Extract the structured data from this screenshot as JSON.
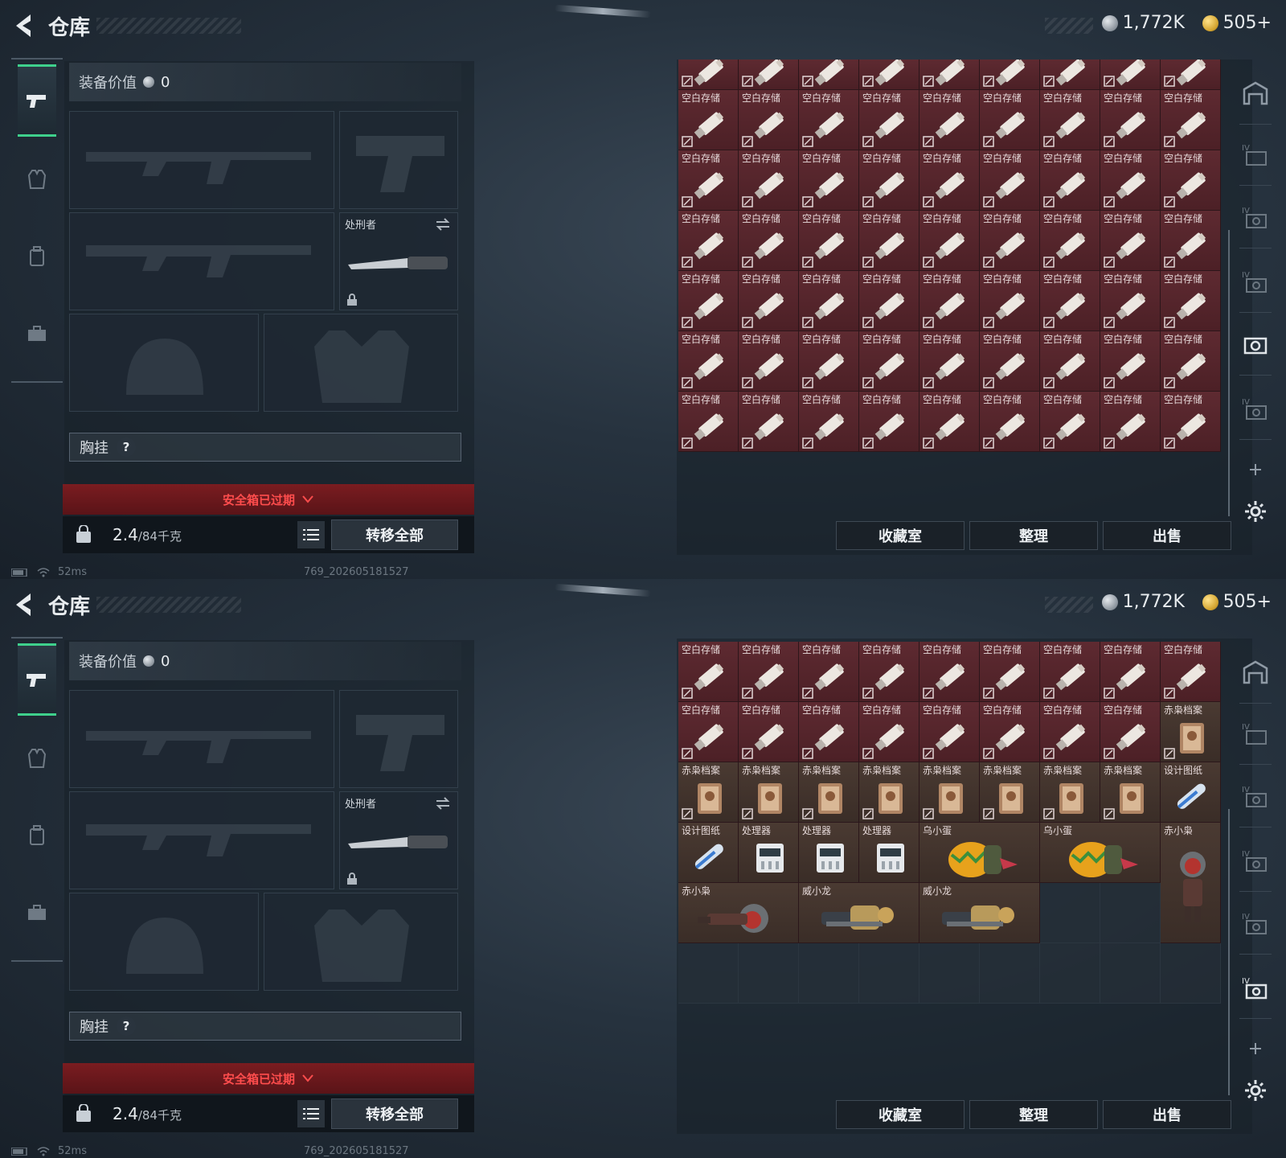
{
  "screens": [
    {
      "title": "仓库",
      "currency_silver": "1,772K",
      "currency_gold": "505+",
      "equip_label": "装备价值",
      "equip_value": "0",
      "knife_slot_label": "处刑者",
      "chest_label": "胸挂",
      "chest_help": "?",
      "expired_text": "安全箱已过期",
      "weight_value": "2.4",
      "weight_cap": "/84千克",
      "transfer_label": "转移全部",
      "ping": "52ms",
      "build_id": "769_202605181527",
      "buttons": [
        "收藏室",
        "整理",
        "出售"
      ]
    },
    {
      "title": "仓库",
      "currency_silver": "1,772K",
      "currency_gold": "505+",
      "equip_label": "装备价值",
      "equip_value": "0",
      "knife_slot_label": "处刑者",
      "chest_label": "胸挂",
      "chest_help": "?",
      "expired_text": "安全箱已过期",
      "weight_value": "2.4",
      "weight_cap": "/84千克",
      "transfer_label": "转移全部",
      "ping": "52ms",
      "build_id": "769_202605181527",
      "buttons": [
        "收藏室",
        "整理",
        "出售"
      ]
    }
  ],
  "grid1": {
    "top_row_label": "",
    "item_label": "空白存储",
    "rows": 7,
    "cols": 9
  },
  "grid2": {
    "items": [
      {
        "label": "空白存储",
        "kind": "usb"
      },
      {
        "label": "空白存储",
        "kind": "usb"
      },
      {
        "label": "空白存储",
        "kind": "usb"
      },
      {
        "label": "空白存储",
        "kind": "usb"
      },
      {
        "label": "空白存储",
        "kind": "usb"
      },
      {
        "label": "空白存储",
        "kind": "usb"
      },
      {
        "label": "空白存储",
        "kind": "usb"
      },
      {
        "label": "空白存储",
        "kind": "usb"
      },
      {
        "label": "空白存储",
        "kind": "usb"
      },
      {
        "label": "空白存储",
        "kind": "usb"
      },
      {
        "label": "空白存储",
        "kind": "usb"
      },
      {
        "label": "空白存储",
        "kind": "usb"
      },
      {
        "label": "空白存储",
        "kind": "usb"
      },
      {
        "label": "空白存储",
        "kind": "usb"
      },
      {
        "label": "空白存储",
        "kind": "usb"
      },
      {
        "label": "空白存储",
        "kind": "usb"
      },
      {
        "label": "空白存储",
        "kind": "usb"
      },
      {
        "label": "赤枭档案",
        "kind": "file"
      },
      {
        "label": "赤枭档案",
        "kind": "file"
      },
      {
        "label": "赤枭档案",
        "kind": "file"
      },
      {
        "label": "赤枭档案",
        "kind": "file"
      },
      {
        "label": "赤枭档案",
        "kind": "file"
      },
      {
        "label": "赤枭档案",
        "kind": "file"
      },
      {
        "label": "赤枭档案",
        "kind": "file"
      },
      {
        "label": "赤枭档案",
        "kind": "file"
      },
      {
        "label": "赤枭档案",
        "kind": "file"
      },
      {
        "label": "设计图纸",
        "kind": "blueprint"
      },
      {
        "label": "设计图纸",
        "kind": "blueprint"
      },
      {
        "label": "处理器",
        "kind": "cpu"
      },
      {
        "label": "处理器",
        "kind": "cpu"
      },
      {
        "label": "处理器",
        "kind": "cpu"
      },
      {
        "label": "乌小蛋",
        "kind": "egg",
        "span": 2
      },
      {
        "label": "乌小蛋",
        "kind": "egg",
        "span": 2
      },
      {
        "label": "赤小枭",
        "kind": "figure",
        "rowspan": 2
      },
      {
        "label": "赤小枭",
        "kind": "figure2",
        "span": 2
      },
      {
        "label": "威小龙",
        "kind": "dragon",
        "span": 2
      },
      {
        "label": "威小龙",
        "kind": "dragon",
        "span": 2
      }
    ]
  }
}
